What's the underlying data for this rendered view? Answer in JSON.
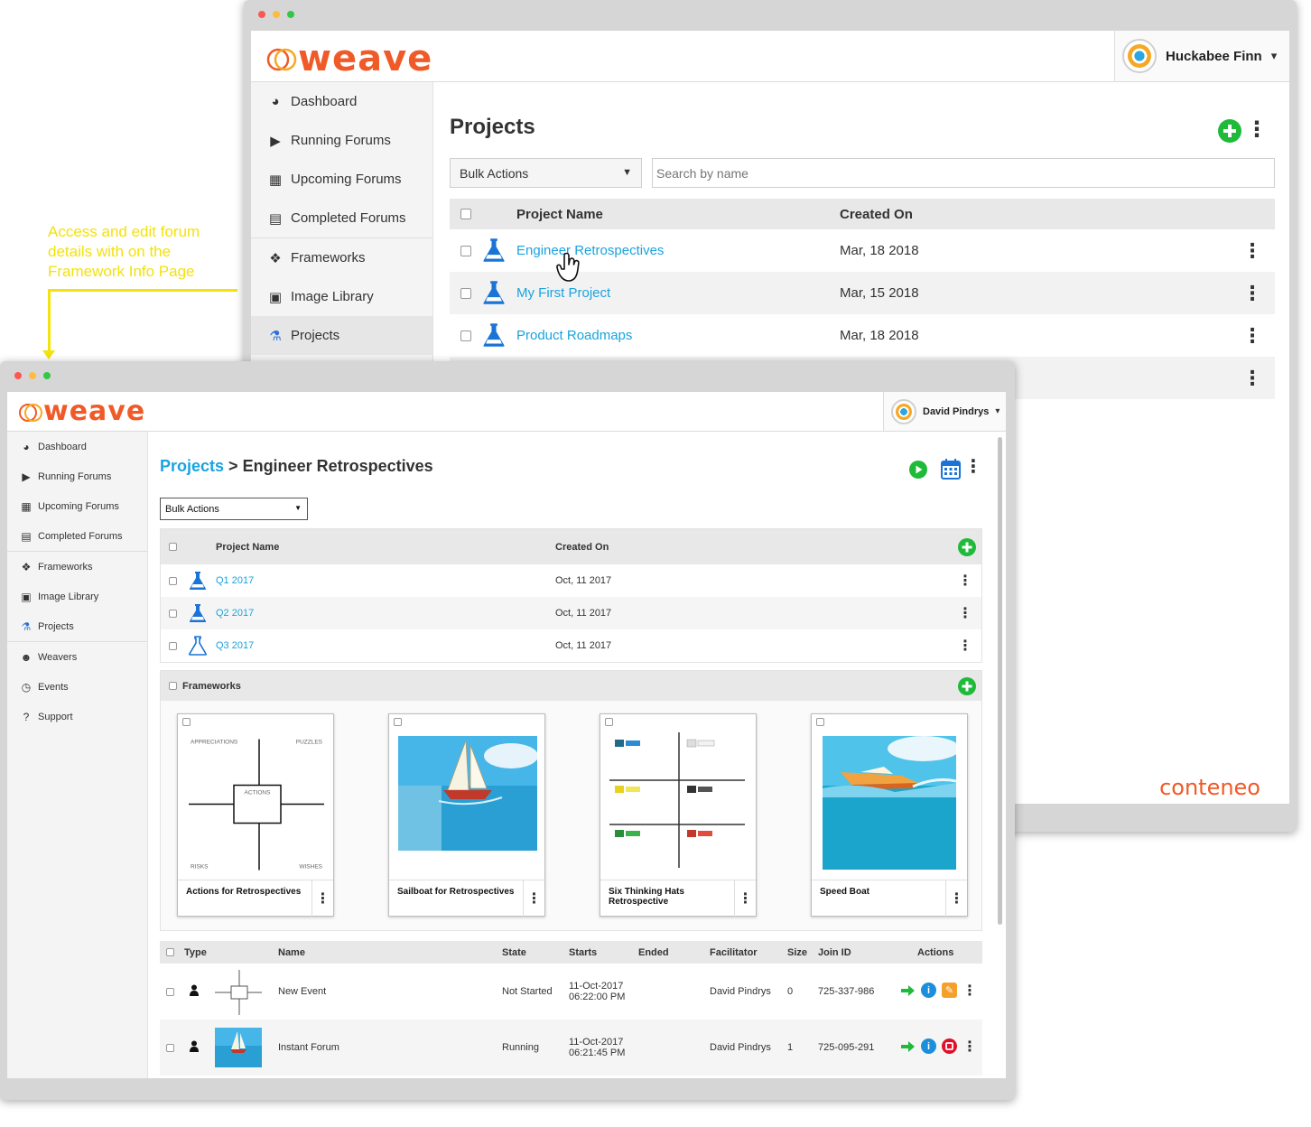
{
  "colors": {
    "brand_orange": "#f05a28",
    "link_blue": "#1aa3df",
    "add_green": "#1fba3a",
    "annotation_yellow": "#f3e20c",
    "stop_red": "#e0102a"
  },
  "annotation": {
    "text": "Access and edit forum details with on the Framework Info Page"
  },
  "back_window": {
    "logo": "weave",
    "user": {
      "name": "Huckabee Finn",
      "caret": "▾"
    },
    "sidebar": [
      {
        "label": "Dashboard",
        "icon": "dashboard-icon",
        "glyph": "◕"
      },
      {
        "label": "Running Forums",
        "icon": "play-circle-icon",
        "glyph": "▶"
      },
      {
        "label": "Upcoming Forums",
        "icon": "calendar-icon",
        "glyph": "▦"
      },
      {
        "label": "Completed Forums",
        "icon": "document-icon",
        "glyph": "▤"
      },
      {
        "label": "Frameworks",
        "icon": "cubes-icon",
        "glyph": "❖"
      },
      {
        "label": "Image Library",
        "icon": "image-icon",
        "glyph": "▣"
      },
      {
        "label": "Projects",
        "icon": "flask-icon",
        "glyph": "⚗"
      }
    ],
    "title": "Projects",
    "bulk_actions": "Bulk Actions",
    "search_placeholder": "Search by name",
    "table": {
      "columns": [
        "Project Name",
        "Created On"
      ],
      "rows": [
        {
          "name": "Engineer Retrospectives",
          "created": "Mar, 18 2018"
        },
        {
          "name": "My First Project",
          "created": "Mar, 15 2018"
        },
        {
          "name": "Product Roadmaps",
          "created": "Mar, 18 2018"
        },
        {
          "name": "",
          "created": ""
        }
      ]
    },
    "footer_brand": "conteneo"
  },
  "front_window": {
    "logo": "weave",
    "user": {
      "name": "David Pindrys",
      "caret": "▾"
    },
    "sidebar": [
      {
        "label": "Dashboard",
        "icon": "dashboard-icon",
        "glyph": "◕"
      },
      {
        "label": "Running Forums",
        "icon": "play-circle-icon",
        "glyph": "▶"
      },
      {
        "label": "Upcoming Forums",
        "icon": "calendar-icon",
        "glyph": "▦"
      },
      {
        "label": "Completed Forums",
        "icon": "document-icon",
        "glyph": "▤"
      },
      {
        "label": "Frameworks",
        "icon": "cubes-icon",
        "glyph": "❖"
      },
      {
        "label": "Image Library",
        "icon": "image-icon",
        "glyph": "▣"
      },
      {
        "label": "Projects",
        "icon": "flask-icon",
        "glyph": "⚗"
      },
      {
        "label": "Weavers",
        "icon": "users-icon",
        "glyph": "☻"
      },
      {
        "label": "Events",
        "icon": "clock-icon",
        "glyph": "◷"
      },
      {
        "label": "Support",
        "icon": "question-icon",
        "glyph": "?"
      }
    ],
    "breadcrumb": {
      "parent": "Projects",
      "separator": " > ",
      "current": "Engineer Retrospectives"
    },
    "bulk_actions": "Bulk Actions",
    "projects_table": {
      "columns": [
        "Project Name",
        "Created On"
      ],
      "rows": [
        {
          "name": "Q1 2017",
          "created": "Oct, 11 2017"
        },
        {
          "name": "Q2 2017",
          "created": "Oct, 11 2017"
        },
        {
          "name": "Q3 2017",
          "created": "Oct, 11 2017"
        }
      ]
    },
    "frameworks": {
      "title": "Frameworks",
      "cards": [
        {
          "name": "Actions for Retrospectives",
          "thumb_labels": [
            "APPRECIATIONS",
            "PUZZLES",
            "ACTIONS",
            "RISKS",
            "WISHES"
          ]
        },
        {
          "name": "Sailboat for Retrospectives"
        },
        {
          "name": "Six Thinking Hats Retrospective"
        },
        {
          "name": "Speed Boat"
        }
      ]
    },
    "events_table": {
      "columns": [
        "Type",
        "Name",
        "State",
        "Starts",
        "Ended",
        "Facilitator",
        "Size",
        "Join ID",
        "Actions"
      ],
      "rows": [
        {
          "name": "New Event",
          "state": "Not Started",
          "starts_date": "11-Oct-2017",
          "starts_time": "06:22:00 PM",
          "ended": "",
          "facilitator": "David Pindrys",
          "size": "0",
          "join_id": "725-337-986"
        },
        {
          "name": "Instant Forum",
          "state": "Running",
          "starts_date": "11-Oct-2017",
          "starts_time": "06:21:45 PM",
          "ended": "",
          "facilitator": "David Pindrys",
          "size": "1",
          "join_id": "725-095-291"
        }
      ]
    }
  }
}
